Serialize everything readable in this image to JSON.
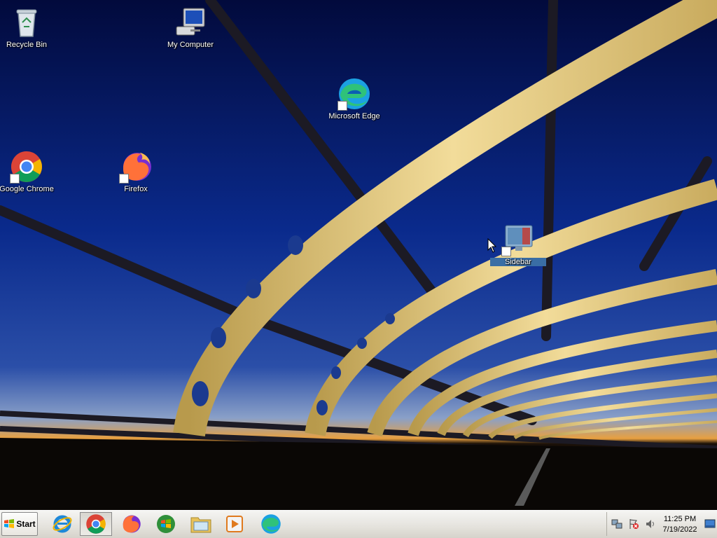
{
  "desktop": {
    "icons": [
      {
        "label": "Recycle Bin",
        "icon": "recycle-bin-icon"
      },
      {
        "label": "My Computer",
        "icon": "my-computer-icon"
      },
      {
        "label": "Microsoft Edge",
        "icon": "edge-icon"
      },
      {
        "label": "Google Chrome",
        "icon": "chrome-icon"
      },
      {
        "label": "Firefox",
        "icon": "firefox-icon"
      },
      {
        "label": "Sidebar",
        "icon": "sidebar-icon"
      }
    ]
  },
  "taskbar": {
    "start_label": "Start",
    "buttons": [
      {
        "icon": "internet-explorer-icon"
      },
      {
        "icon": "chrome-icon"
      },
      {
        "icon": "firefox-icon"
      },
      {
        "icon": "windows-media-center-icon"
      },
      {
        "icon": "file-explorer-icon"
      },
      {
        "icon": "media-player-icon"
      },
      {
        "icon": "edge-icon"
      }
    ],
    "tray": {
      "time": "11:25 PM",
      "date": "7/19/2022"
    }
  },
  "colors": {
    "sky_top": "#020a3c",
    "sky_mid": "#0a2e9a",
    "horizon": "#e8a040",
    "bridge": "#e8d08a",
    "taskbar": "#e4e2dc"
  }
}
